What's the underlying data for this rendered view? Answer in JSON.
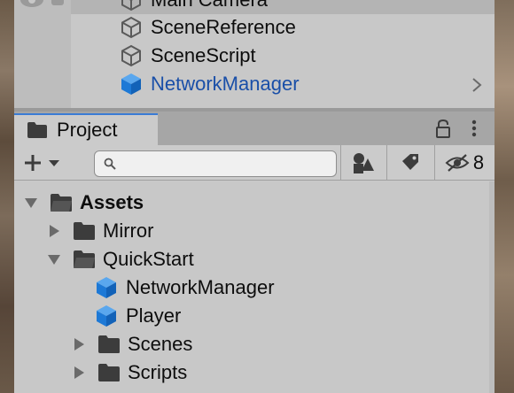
{
  "hierarchy": {
    "items": [
      {
        "label": "Main Camera",
        "icon": "gameobject-outline-icon"
      },
      {
        "label": "SceneReference",
        "icon": "gameobject-outline-icon"
      },
      {
        "label": "SceneScript",
        "icon": "gameobject-outline-icon"
      },
      {
        "label": "NetworkManager",
        "icon": "prefab-cube-icon",
        "color": "#1a4fa8"
      }
    ]
  },
  "project": {
    "tab_label": "Project",
    "search": {
      "value": "",
      "placeholder": ""
    },
    "hidden_count": "8",
    "tree": [
      {
        "label": "Assets",
        "expanded": true,
        "type": "folder",
        "bold": true
      },
      {
        "label": "Mirror",
        "expanded": false,
        "type": "folder"
      },
      {
        "label": "QuickStart",
        "expanded": true,
        "type": "folder"
      },
      {
        "label": "NetworkManager",
        "type": "prefab"
      },
      {
        "label": "Player",
        "type": "prefab"
      },
      {
        "label": "Scenes",
        "expanded": false,
        "type": "folder"
      },
      {
        "label": "Scripts",
        "expanded": false,
        "type": "folder"
      }
    ]
  },
  "colors": {
    "accent": "#3a7bd5",
    "prefab_blue": "#1d79d6",
    "panel_bg": "#c8c8c8"
  }
}
